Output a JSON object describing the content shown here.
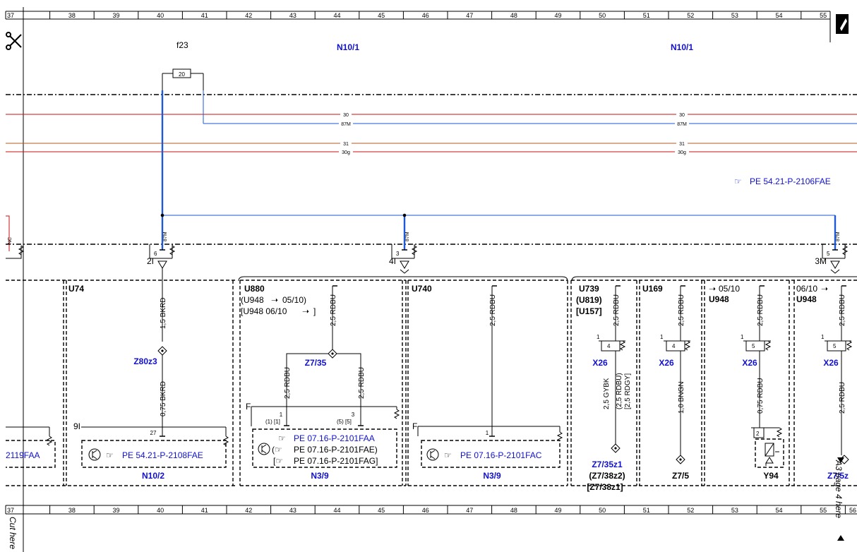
{
  "columns": [
    "37",
    "38",
    "39",
    "40",
    "41",
    "42",
    "43",
    "44",
    "45",
    "46",
    "47",
    "48",
    "49",
    "50",
    "51",
    "52",
    "53",
    "54",
    "55",
    "56"
  ],
  "fuse": {
    "name": "f23",
    "rating": "20"
  },
  "modules": {
    "left": "N10/1",
    "right": "N10/1"
  },
  "rails": {
    "r30": "30",
    "r87m": "87M",
    "r31": "31",
    "r30g": "30g"
  },
  "ref_top": "PE 54.21-P-2106FAE",
  "tap_label": "87M",
  "left_tap": "NC",
  "connectors": [
    {
      "pin": "6",
      "id": "2I"
    },
    {
      "pin": "3",
      "id": "4I"
    },
    {
      "pin": "5",
      "id": "3M"
    }
  ],
  "sections": {
    "u74": {
      "code": "U74",
      "wire1": "1,5 BKRD",
      "splice": "Z80z3",
      "wire2": "0,75 BKRD",
      "conn": "9I",
      "pin": "27",
      "ref": "PE 54.21-P-2108FAE",
      "module": "N10/2"
    },
    "u880": {
      "code": "U880",
      "line2": "(U948",
      "line2b": "05/10)",
      "line3": "[U948  06/10",
      "line3b": "]",
      "wire": "2,5 RDBU",
      "splice": "Z7/35",
      "wire_l": "2,5 RDBU",
      "wire_r": "2,5 RDBU",
      "flag": "F",
      "pin_l": "1",
      "pin_l_alt": "(1) [1]",
      "pin_r": "3",
      "pin_r_alt": "(5) [5]",
      "ref1": "PE 07.16-P-2101FAA",
      "ref2": "PE 07.16-P-2101FAE)",
      "ref3": "PE 07.16-P-2101FAG]",
      "module": "N3/9"
    },
    "u740": {
      "code": "U740",
      "wire": "2,5 RDBU",
      "flag": "F",
      "pin": "1",
      "ref": "PE 07.16-P-2101FAC",
      "module": "N3/9"
    },
    "u739": {
      "code": "U739",
      "line2": "(U819)",
      "line3": "[U157]",
      "wire": "2,5 RDBU",
      "conn": "X26",
      "pin": "4",
      "pin1": "1",
      "wire2": "2,5 GYBK",
      "wire2b": "(2,5 RDBU)",
      "wire2c": "[2,5 RDGY]",
      "splice": "Z7/35z1",
      "splice2": "(Z7/38z2)",
      "splice3": "[Z7/38z1]"
    },
    "u169": {
      "code": "U169",
      "wire": "2,5 RDBU",
      "conn": "X26",
      "pin": "4",
      "pin1": "1",
      "wire2": "1,0 BNGN",
      "splice": "Z7/5"
    },
    "u948a": {
      "date": "05/10",
      "code": "U948",
      "wire": "2,5 RDBU",
      "conn": "X26",
      "pin": "5",
      "pin1": "1",
      "wire2": "0,75 RDBU",
      "pin2": "2",
      "comp": "Y94"
    },
    "u948b": {
      "date": "06/10",
      "code": "U948",
      "wire": "2,5 RDBU",
      "conn": "X26",
      "pin": "5",
      "pin1": "1",
      "wire2": "2,5 RDBU",
      "splice": "Z7/5z"
    }
  },
  "left_ref": "2119FAA",
  "cut_here": "Cut here",
  "page_side": "A3 page 4 here",
  "colors": {
    "blue": "#1010d0",
    "red": "#cc1010",
    "brown": "#b05a20",
    "navy": "#1e5ad8"
  }
}
